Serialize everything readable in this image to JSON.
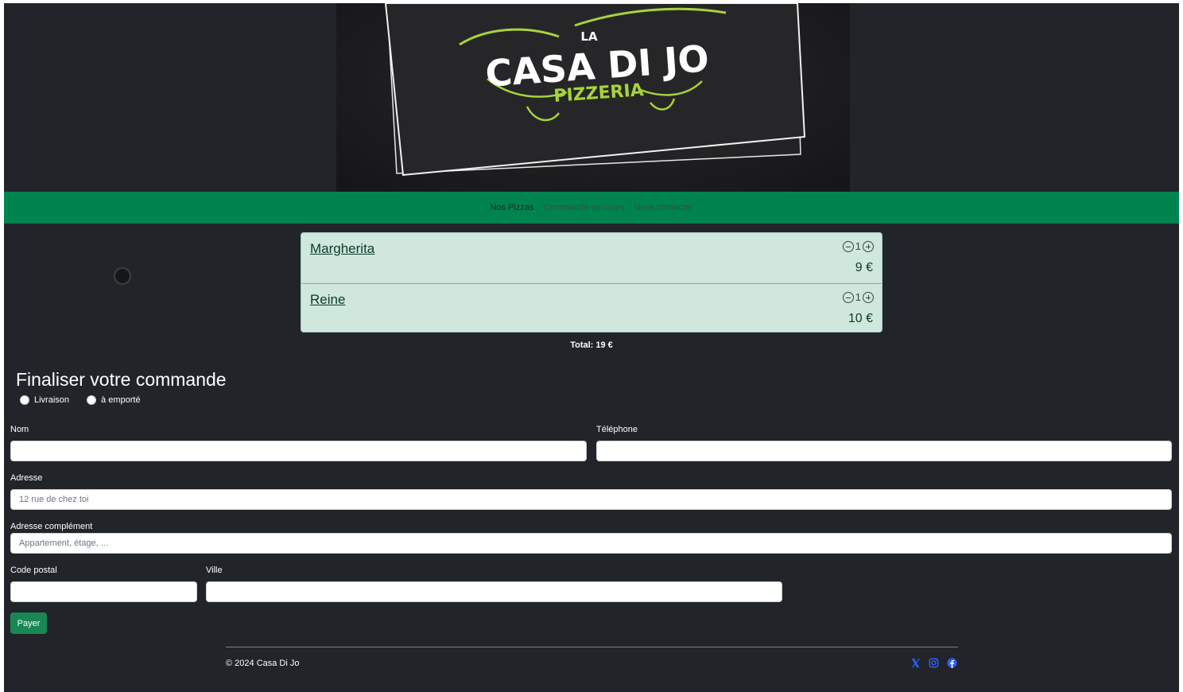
{
  "logo": {
    "line1": "LA",
    "line2": "CASA DI JO",
    "line3": "PIZZERIA"
  },
  "nav": {
    "items": [
      {
        "label": "Nos Pizzas",
        "active": true
      },
      {
        "label": "Commande en cours",
        "active": false
      },
      {
        "label": "Nous contacter",
        "active": false
      }
    ]
  },
  "cart": {
    "items": [
      {
        "name": "Margherita",
        "qty": "1",
        "price": "9 €"
      },
      {
        "name": "Reine",
        "qty": "1",
        "price": "10 €"
      }
    ],
    "total": "Total: 19 €"
  },
  "form": {
    "title": "Finaliser votre commande",
    "delivery_options": [
      "Livraison",
      "à emporté"
    ],
    "fields": {
      "nom": {
        "label": "Nom",
        "placeholder": ""
      },
      "telephone": {
        "label": "Téléphone",
        "placeholder": ""
      },
      "adresse": {
        "label": "Adresse",
        "placeholder": "12 rue de chez toi"
      },
      "complement": {
        "label": "Adresse complément",
        "placeholder": "Appartement, étage, ..."
      },
      "code_postal": {
        "label": "Code postal",
        "placeholder": ""
      },
      "ville": {
        "label": "Ville",
        "placeholder": ""
      }
    },
    "pay_label": "Payer"
  },
  "footer": {
    "copyright": "© 2024 Casa Di Jo",
    "social_icons": [
      "x-icon",
      "instagram-icon",
      "facebook-icon"
    ],
    "icon_color": "#2f5cff"
  },
  "colors": {
    "background": "#212529",
    "nav": "#00834f",
    "cart_bg": "#cfe7dd",
    "pay_button": "#198754",
    "logo_green": "#a6d33b"
  }
}
